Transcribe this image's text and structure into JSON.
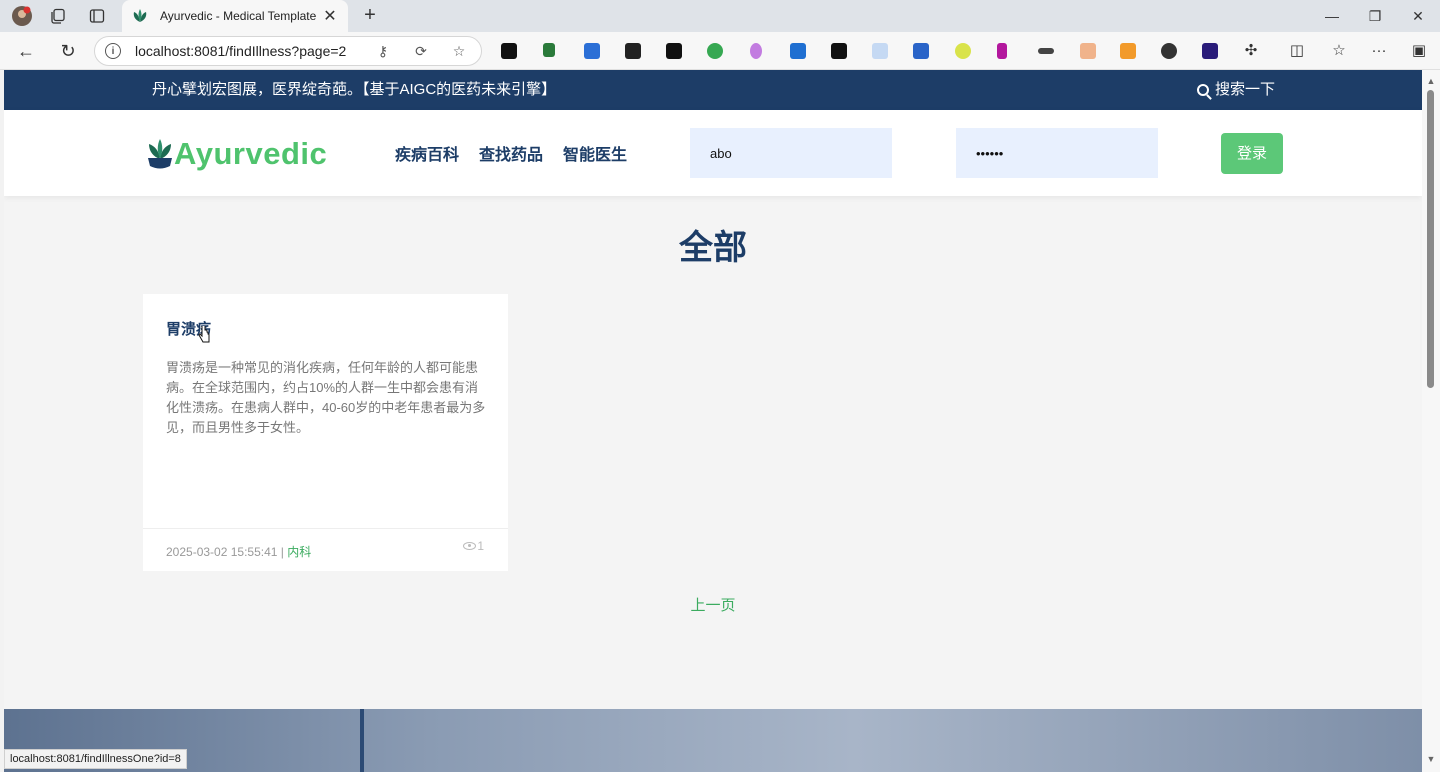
{
  "browser": {
    "tab": {
      "title": "Ayurvedic - Medical Template",
      "favicon": "leaf-icon"
    },
    "url": "localhost:8081/findIllness?page=2",
    "status_url": "localhost:8081/findIllnessOne?id=8",
    "icons": {
      "profile": "profile-avatar-icon",
      "collections": "collections-icon",
      "tab_actions": "tab-actions-icon",
      "back": "back-arrow-icon",
      "refresh": "refresh-icon",
      "info": "site-info-icon",
      "extensions": "extensions-icon",
      "split": "split-screen-icon",
      "favorites": "favorites-icon",
      "more": "more-icon",
      "sidebar": "sidebar-toggle-icon"
    }
  },
  "site": {
    "topbar": {
      "slogan": "丹心擘划宏图展，医界绽奇葩。【基于AIGC的医药未来引擎】",
      "search_label": "搜索一下"
    },
    "logo": {
      "text_green": "Ayur",
      "text_dark": "vedic"
    },
    "nav": [
      "疾病百科",
      "查找药品",
      "智能医生"
    ],
    "login": {
      "username_value": "abo",
      "password_value": "••••••",
      "button_label": "登录"
    },
    "section_title": "全部",
    "cards": [
      {
        "title": "胃溃疡",
        "description": "胃溃疡是一种常见的消化疾病，任何年龄的人都可能患病。在全球范围内，约占10%的人群一生中都会患有消化性溃疡。在患病人群中，40-60岁的中老年患者最为多见，而且男性多于女性。",
        "date": "2025-03-02 15:55:41",
        "separator": " | ",
        "category": "内科",
        "views": "1"
      }
    ],
    "pagination": {
      "prev_label": "上一页"
    }
  },
  "colors": {
    "navy": "#1d3d67",
    "brand_green": "#4fc36d",
    "button_green": "#5cc878",
    "link_green": "#3bab5f"
  }
}
